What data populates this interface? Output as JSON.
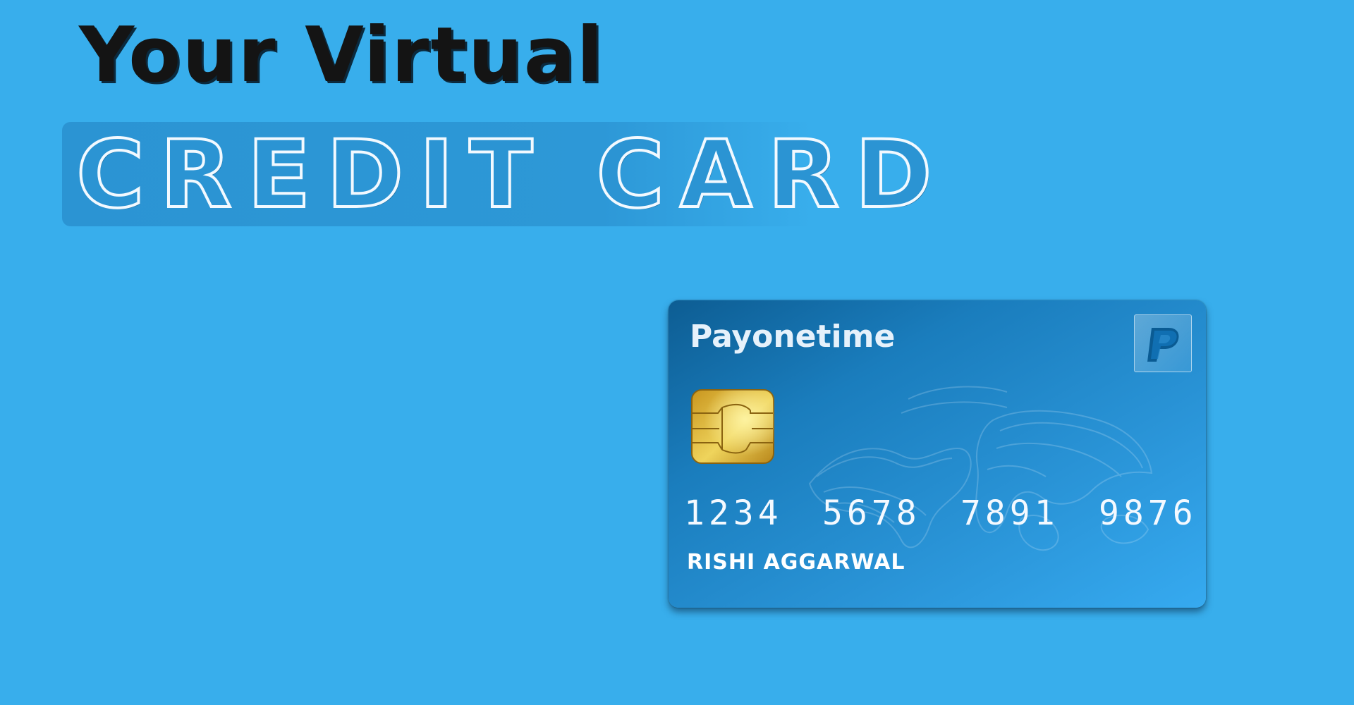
{
  "heading": {
    "line1": "Your Virtual",
    "line2": "CREDIT CARD"
  },
  "card": {
    "brand": "Payonetime",
    "number_groups": [
      "1234",
      "5678",
      "7891",
      "9876"
    ],
    "holder": "RISHI AGGARWAL",
    "logo_icon": "payonetime-p-logo-icon",
    "chip_icon": "emv-chip-icon",
    "background_icon": "world-map-icon"
  },
  "colors": {
    "background": "#38aeec",
    "card_dark": "#0d5d93",
    "card_light": "#36aaf0",
    "chip_gold": "#d4a52a"
  }
}
